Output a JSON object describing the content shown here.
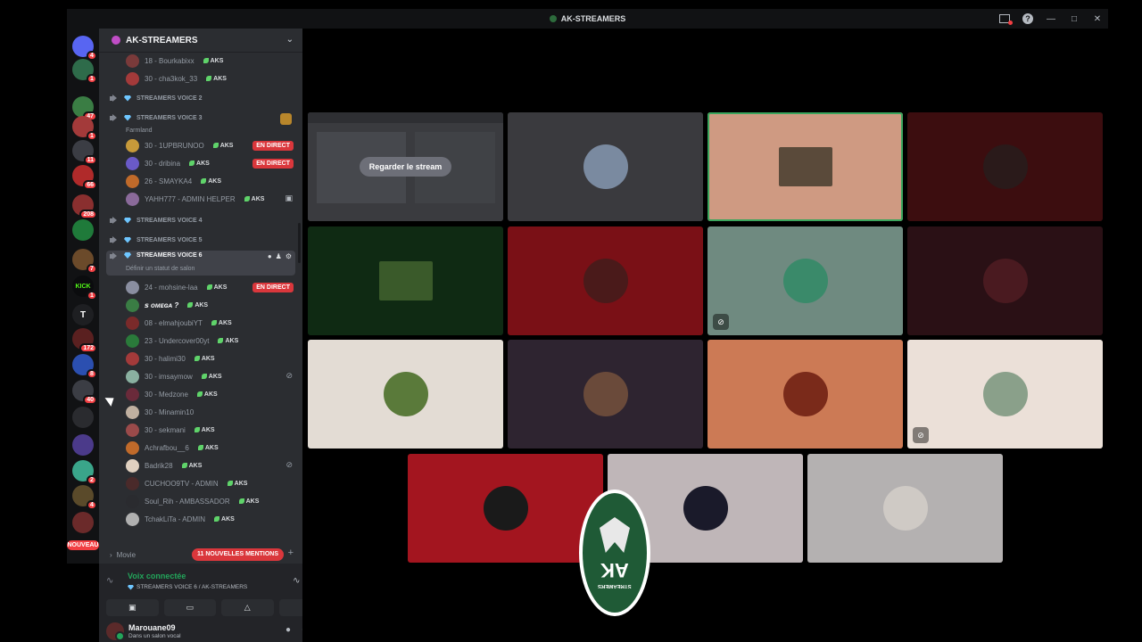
{
  "window": {
    "title": "AK-STREAMERS"
  },
  "rail": {
    "servers": [
      {
        "name": "discord-home",
        "label": "",
        "badge": "4",
        "color": "#5865f2"
      },
      {
        "name": "server-1",
        "label": "",
        "badge": "1",
        "color": "#2e6b4a"
      },
      {
        "name": "server-2",
        "label": "",
        "badge": "47",
        "color": "#3a7d44"
      },
      {
        "name": "server-3",
        "label": "",
        "badge": "1",
        "color": "#a33a3a"
      },
      {
        "name": "server-4",
        "label": "",
        "badge": "11",
        "color": "#3b3d44"
      },
      {
        "name": "server-5",
        "label": "",
        "badge": "66",
        "color": "#b02a2a"
      },
      {
        "name": "server-6",
        "label": "",
        "badge": "208",
        "color": "#8a2f2f"
      },
      {
        "name": "server-7",
        "label": "",
        "badge": "",
        "color": "#1f7a3a"
      },
      {
        "name": "server-8",
        "label": "",
        "badge": "7",
        "color": "#6b4a2a"
      },
      {
        "name": "server-kick",
        "label": "KICK",
        "badge": "1",
        "color": "#0b0c0e"
      },
      {
        "name": "server-t",
        "label": "T",
        "badge": "",
        "color": "#1e1f22"
      },
      {
        "name": "server-9",
        "label": "",
        "badge": "172",
        "color": "#5a2020"
      },
      {
        "name": "server-10",
        "label": "",
        "badge": "8",
        "color": "#2b4fb0"
      },
      {
        "name": "server-11",
        "label": "",
        "badge": "40",
        "color": "#3b3d44"
      },
      {
        "name": "server-12",
        "label": "",
        "badge": "",
        "color": "#2a2b2f"
      },
      {
        "name": "server-13",
        "label": "",
        "badge": "",
        "color": "#4b3a8a"
      },
      {
        "name": "server-14",
        "label": "",
        "badge": "2",
        "color": "#3aa58a"
      },
      {
        "name": "server-15",
        "label": "",
        "badge": "4",
        "color": "#5a4a2a"
      },
      {
        "name": "server-16",
        "label": "",
        "badge": "",
        "color": "#6b2a2a"
      }
    ],
    "nouveau": "NOUVEAU"
  },
  "sidebar": {
    "guild_name": "AK-STREAMERS",
    "tag": "AKS",
    "top_members": [
      {
        "name": "18 - Bourkabixx",
        "color": "#7a3a3a"
      },
      {
        "name": "30 - cha3kok_33",
        "color": "#a33a3a"
      }
    ],
    "voice2": "STREAMERS VOICE 2",
    "voice3": "STREAMERS VOICE 3",
    "voice3_status": "Farmland",
    "voice3_members": [
      {
        "name": "30 - 1UPBRUNOO",
        "live": "EN DIRECT",
        "color": "#c79a3a"
      },
      {
        "name": "30 - dribina",
        "live": "EN DIRECT",
        "color": "#6a5ac7"
      },
      {
        "name": "26 - SMAYKA4",
        "live": "",
        "color": "#c06a2a"
      },
      {
        "name": "YAHH777 - ADMIN HELPER",
        "live": "",
        "color": "#8a6a9a"
      }
    ],
    "voice4": "STREAMERS VOICE 4",
    "voice5": "STREAMERS VOICE 5",
    "voice6": "STREAMERS VOICE 6",
    "voice6_status": "Définir un statut de salon",
    "voice6_members": [
      {
        "name": "24 - mohsine-laa",
        "live": "EN DIRECT",
        "tag": true,
        "color": "#8a8ea0"
      },
      {
        "name": "ꜱ ᴏᴍᴇɢᴀ ?",
        "live": "",
        "tag": true,
        "color": "#3a7d44"
      },
      {
        "name": "08 - elmahjoubiYT",
        "live": "",
        "tag": true,
        "color": "#7a2a2a"
      },
      {
        "name": "23 - Undercover00yt",
        "live": "",
        "tag": true,
        "color": "#2a7a3a"
      },
      {
        "name": "30 - halimi30",
        "live": "",
        "tag": true,
        "color": "#a33a3a"
      },
      {
        "name": "30 - imsaymow",
        "live": "",
        "tag": true,
        "color": "#8ab0a0"
      },
      {
        "name": "30 - Medzone",
        "live": "",
        "tag": true,
        "color": "#6a2a3a"
      },
      {
        "name": "30 - Minamin10",
        "live": "",
        "tag": false,
        "color": "#c0b0a0"
      },
      {
        "name": "30 - sekmani",
        "live": "",
        "tag": true,
        "color": "#9a4a4a"
      },
      {
        "name": "Achrafbou__6",
        "live": "",
        "tag": true,
        "color": "#c06a2a"
      },
      {
        "name": "Badrik28",
        "live": "",
        "tag": true,
        "color": "#e0d0c0"
      },
      {
        "name": "CUCHOO9TV - ADMIN",
        "live": "",
        "tag": true,
        "color": "#4a2a2a"
      },
      {
        "name": "Soul_Rih - AMBASSADOR",
        "live": "",
        "tag": true,
        "color": "#2a2b2f"
      },
      {
        "name": "TchakLiTa - ADMIN",
        "live": "",
        "tag": true,
        "color": "#b0b0b0"
      }
    ],
    "movie": "Movie",
    "mentions": "11 NOUVELLES MENTIONS"
  },
  "voice_panel": {
    "connected": "Voix connectée",
    "channel": "STREAMERS VOICE 6 / AK-STREAMERS",
    "username": "Marouane09",
    "status": "Dans un salon vocal"
  },
  "grid": {
    "watch_label": "Regarder le stream",
    "tiles": [
      {
        "name": "tile-stream",
        "bg": "#3a3b3f"
      },
      {
        "name": "tile-2",
        "bg": "#3a3a3e",
        "av": "#7a8aa0"
      },
      {
        "name": "tile-3",
        "bg": "#cf9a82",
        "av": "#5a4a3a"
      },
      {
        "name": "tile-4",
        "bg": "#3c0d0f",
        "av": "#2a1a1a"
      },
      {
        "name": "tile-5",
        "bg": "#0f2a13",
        "av": "#3a5a2a"
      },
      {
        "name": "tile-6",
        "bg": "#7a1016",
        "av": "#4a1a1a"
      },
      {
        "name": "tile-7",
        "bg": "#6f8a80",
        "av": "#3a8a6a"
      },
      {
        "name": "tile-8",
        "bg": "#2a1015",
        "av": "#4a1a20"
      },
      {
        "name": "tile-9",
        "bg": "#e3dcd4",
        "av": "#5a7a3a"
      },
      {
        "name": "tile-10",
        "bg": "#2e2430",
        "av": "#6a4a3a"
      },
      {
        "name": "tile-11",
        "bg": "#cc7a55",
        "av": "#7a2a1a"
      },
      {
        "name": "tile-12",
        "bg": "#ebe0d8",
        "av": "#8aa08a"
      },
      {
        "name": "tile-13",
        "bg": "#a3151f",
        "av": "#1a1a1a"
      },
      {
        "name": "tile-14",
        "bg": "#bfb6b8",
        "av": "#1a1a2a"
      },
      {
        "name": "tile-15",
        "bg": "#b4b1b1",
        "av": "#cfcac5"
      }
    ]
  },
  "overlay": {
    "logo_text": "AK",
    "logo_sub": "STREAMERS"
  }
}
